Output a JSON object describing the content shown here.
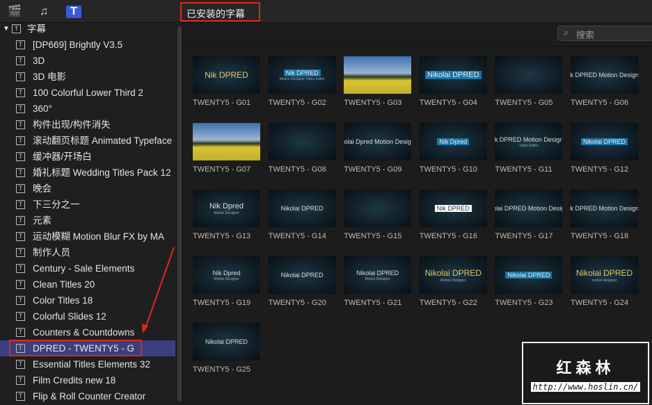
{
  "toolbar": {
    "library_select": "已安装的字幕",
    "icons": [
      "clapper-star-icon",
      "music-icon",
      "titles-icon"
    ]
  },
  "search": {
    "placeholder": "搜索"
  },
  "sidebar": {
    "header": "字幕",
    "items": [
      "[DP669] Brightly V3.5",
      "3D",
      "3D 电影",
      "100 Colorful Lower Third 2",
      "360°",
      "构件出现/构件消失",
      "滚动翻页标题 Animated Typeface",
      "缓冲器/开场白",
      "婚礼标题 Wedding Titles Pack 12",
      "晚会",
      "下三分之一",
      "元素",
      "运动模糊 Motion Blur FX by MA",
      "制作人员",
      "Century - Sale Elements",
      "Clean Titles 20",
      "Color Titles 18",
      "Colorful Slides 12",
      "Counters & Countdowns",
      "DPRED - TWENTY5 - G",
      "Essential Titles Elements 32",
      "Film Credits new 18",
      "Flip & Roll Counter Creator"
    ],
    "selected_index": 19
  },
  "tiles": [
    {
      "label": "TWENTY5 - G01",
      "main": "Nik DPRED",
      "sub": "",
      "style": "gold"
    },
    {
      "label": "TWENTY5 - G02",
      "main": "Nik DPRED",
      "sub": "Motion Designer Video Editor",
      "style": "blue"
    },
    {
      "label": "TWENTY5 - G03",
      "main": "",
      "sub": "",
      "style": "img"
    },
    {
      "label": "TWENTY5 - G04",
      "main": "Nikolai DPRED",
      "sub": "",
      "style": "blue big"
    },
    {
      "label": "TWENTY5 - G05",
      "main": "",
      "sub": "",
      "style": "blue"
    },
    {
      "label": "TWENTY5 - G06",
      "main": "Nik DPRED Motion Designer",
      "sub": "",
      "style": ""
    },
    {
      "label": "TWENTY5 - G07",
      "main": "",
      "sub": "",
      "style": "img"
    },
    {
      "label": "TWENTY5 - G08",
      "main": "",
      "sub": "",
      "style": ""
    },
    {
      "label": "TWENTY5 - G09",
      "main": "Nikolai Dpred Motion Designer",
      "sub": "",
      "style": ""
    },
    {
      "label": "TWENTY5 - G10",
      "main": "Nik Dpred",
      "sub": "",
      "style": "blue"
    },
    {
      "label": "TWENTY5 - G11",
      "main": "Nik DPRED Motion Designer",
      "sub": "Video Editor",
      "style": ""
    },
    {
      "label": "TWENTY5 - G12",
      "main": "Nikolai DPRED",
      "sub": "",
      "style": "blue"
    },
    {
      "label": "TWENTY5 - G13",
      "main": "Nik Dpred",
      "sub": "Motion Designer",
      "style": "big"
    },
    {
      "label": "TWENTY5 - G14",
      "main": "Nikolai DPRED",
      "sub": "",
      "style": ""
    },
    {
      "label": "TWENTY5 - G15",
      "main": "",
      "sub": "",
      "style": ""
    },
    {
      "label": "TWENTY5 - G16",
      "main": "Nik DPRED",
      "sub": "",
      "style": "white"
    },
    {
      "label": "TWENTY5 - G17",
      "main": "Nikolai DPRED Motion Designer",
      "sub": "",
      "style": ""
    },
    {
      "label": "TWENTY5 - G18",
      "main": "Nik DPRED Motion Designer",
      "sub": "",
      "style": ""
    },
    {
      "label": "TWENTY5 - G19",
      "main": "Nik Dpred",
      "sub": "Motion Designer",
      "style": ""
    },
    {
      "label": "TWENTY5 - G20",
      "main": "Nikolai DPRED",
      "sub": "",
      "style": ""
    },
    {
      "label": "TWENTY5 - G21",
      "main": "Nikolai DPRED",
      "sub": "Motion Designer",
      "style": ""
    },
    {
      "label": "TWENTY5 - G22",
      "main": "Nikolai DPRED",
      "sub": "Motion Designer",
      "style": "gold"
    },
    {
      "label": "TWENTY5 - G23",
      "main": "Nikolai DPRED",
      "sub": "",
      "style": "blue"
    },
    {
      "label": "TWENTY5 - G24",
      "main": "Nikolai DPRED",
      "sub": "motion designer",
      "style": "gold"
    },
    {
      "label": "TWENTY5 - G25",
      "main": "Nikolai DPRED",
      "sub": "",
      "style": ""
    }
  ],
  "watermark": {
    "title": "红森林",
    "url": "http://www.hoslin.cn/"
  },
  "colors": {
    "selection": "#3b3f7d",
    "highlight": "#e0281e"
  }
}
